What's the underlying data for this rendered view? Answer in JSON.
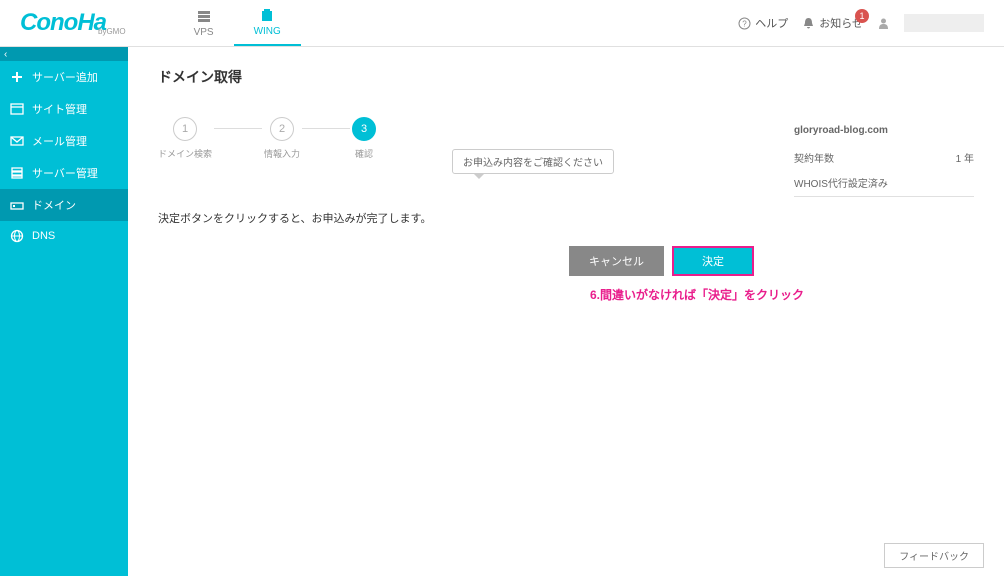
{
  "logo": {
    "main": "ConoHa",
    "sub": "byGMO"
  },
  "topnav": [
    {
      "label": "VPS",
      "active": false
    },
    {
      "label": "WING",
      "active": true
    }
  ],
  "header": {
    "help": "ヘルプ",
    "notifications": "お知らせ",
    "notif_count": "1"
  },
  "sidebar": [
    {
      "icon": "plus",
      "label": "サーバー追加"
    },
    {
      "icon": "site",
      "label": "サイト管理"
    },
    {
      "icon": "mail",
      "label": "メール管理"
    },
    {
      "icon": "server",
      "label": "サーバー管理"
    },
    {
      "icon": "domain",
      "label": "ドメイン",
      "active": true
    },
    {
      "icon": "dns",
      "label": "DNS"
    }
  ],
  "page_title": "ドメイン取得",
  "tooltip": "お申込み内容をご確認ください",
  "steps": [
    {
      "num": "1",
      "label": "ドメイン検索"
    },
    {
      "num": "2",
      "label": "情報入力"
    },
    {
      "num": "3",
      "label": "確認",
      "active": true
    }
  ],
  "info": {
    "domain": "gloryroad-blog.com",
    "contract_label": "契約年数",
    "contract_value": "1 年",
    "whois": "WHOIS代行設定済み"
  },
  "confirm_text": "決定ボタンをクリックすると、お申込みが完了します。",
  "buttons": {
    "cancel": "キャンセル",
    "confirm": "決定"
  },
  "annotation": "6.間違いがなければ「決定」をクリック",
  "feedback": "フィードバック"
}
